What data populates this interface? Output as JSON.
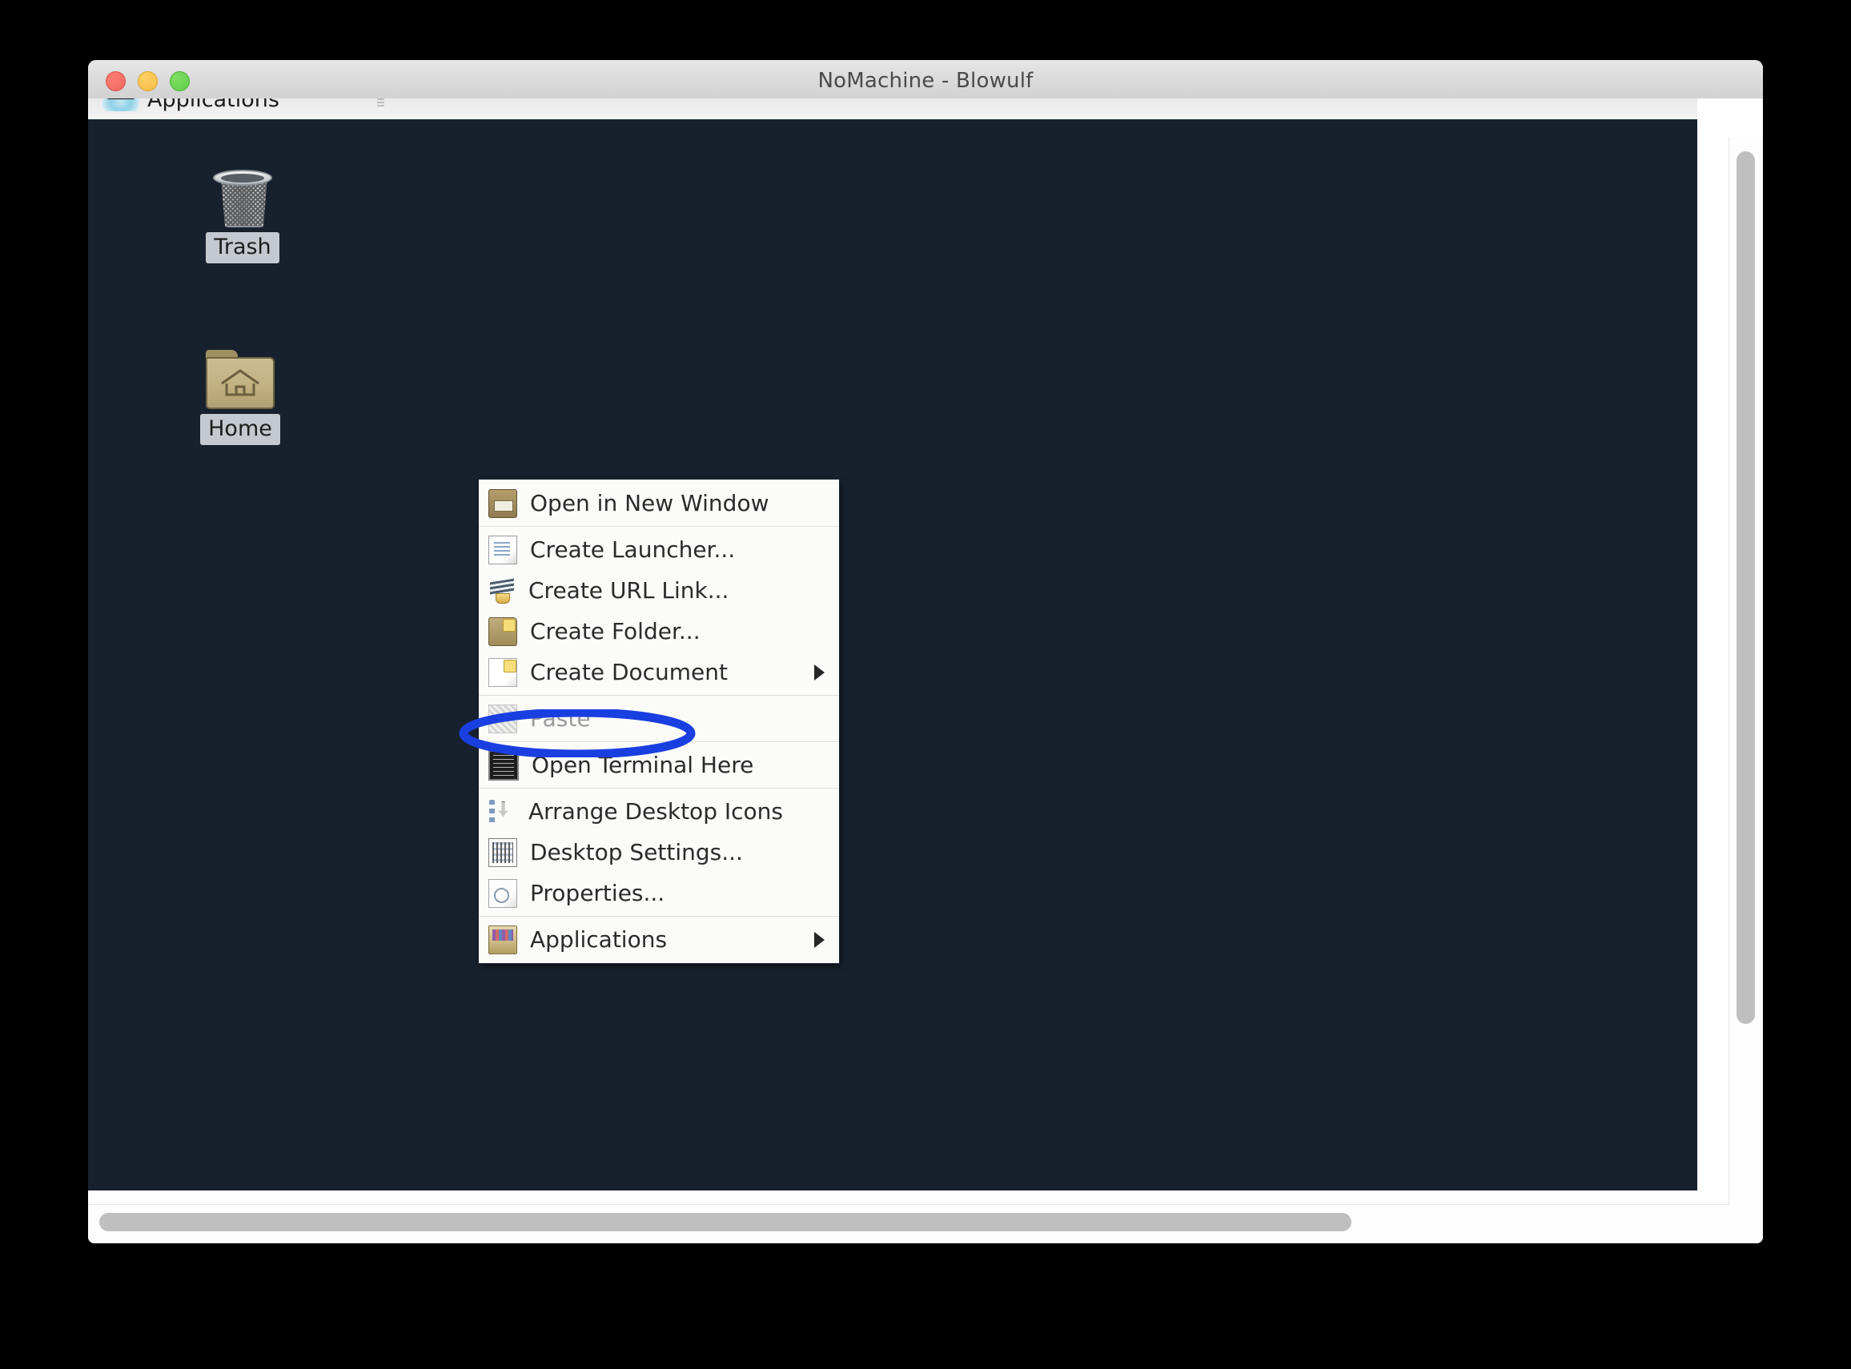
{
  "window": {
    "title": "NoMachine - Blowulf",
    "controls": {
      "close": "close-button",
      "minimize": "minimize-button",
      "zoom": "zoom-button"
    }
  },
  "panel": {
    "applications_label": "Applications"
  },
  "desktop": {
    "background_color": "#17212e",
    "icons": [
      {
        "label": "Trash",
        "icon": "trash-icon"
      },
      {
        "label": "Home",
        "icon": "home-folder-icon"
      }
    ]
  },
  "context_menu": {
    "items": [
      {
        "label": "Open in New Window",
        "icon": "open-folder-icon",
        "disabled": false,
        "submenu": false,
        "separator_after": true
      },
      {
        "label": "Create Launcher...",
        "icon": "document-icon",
        "disabled": false,
        "submenu": false,
        "separator_after": false
      },
      {
        "label": "Create URL Link...",
        "icon": "url-link-icon",
        "disabled": false,
        "submenu": false,
        "separator_after": false
      },
      {
        "label": "Create Folder...",
        "icon": "new-folder-icon",
        "disabled": false,
        "submenu": false,
        "separator_after": false
      },
      {
        "label": "Create Document",
        "icon": "new-document-icon",
        "disabled": false,
        "submenu": true,
        "separator_after": true
      },
      {
        "label": "Paste",
        "icon": "paste-icon",
        "disabled": true,
        "submenu": false,
        "separator_after": true
      },
      {
        "label": "Open Terminal Here",
        "icon": "terminal-icon",
        "disabled": false,
        "submenu": false,
        "separator_after": true
      },
      {
        "label": "Arrange Desktop Icons",
        "icon": "arrange-icon",
        "disabled": false,
        "submenu": false,
        "separator_after": false
      },
      {
        "label": "Desktop Settings...",
        "icon": "desktop-settings-icon",
        "disabled": false,
        "submenu": false,
        "separator_after": false
      },
      {
        "label": "Properties...",
        "icon": "properties-icon",
        "disabled": false,
        "submenu": false,
        "separator_after": true
      },
      {
        "label": "Applications",
        "icon": "applications-icon",
        "disabled": false,
        "submenu": true,
        "separator_after": false
      }
    ]
  },
  "annotation": {
    "shape": "ellipse",
    "color": "#1a3fe0",
    "targets": "Open Terminal Here"
  }
}
